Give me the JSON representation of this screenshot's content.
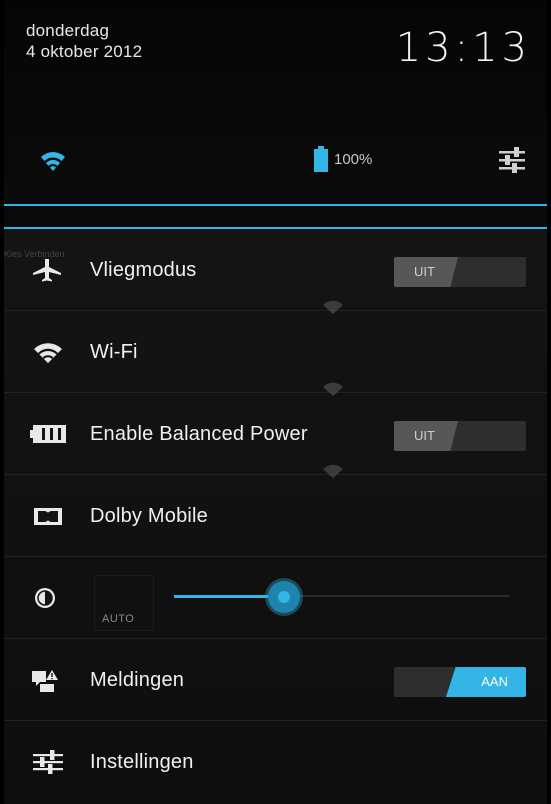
{
  "status": {
    "day": "donderdag",
    "date": "4 oktober 2012",
    "time": "13:13",
    "battery_percent": "100%",
    "battery_level": 1.0
  },
  "background_hint": "Kies Verbinden",
  "rows": [
    {
      "label": "Vliegmodus",
      "icon": "airplane-icon",
      "toggle": "UIT",
      "toggle_on": false
    },
    {
      "label": "Wi-Fi",
      "icon": "wifi-icon"
    },
    {
      "label": "Enable Balanced Power",
      "icon": "battery-icon",
      "toggle": "UIT",
      "toggle_on": false
    },
    {
      "label": "Dolby Mobile",
      "icon": "dolby-icon"
    },
    {
      "brightness_auto": "AUTO",
      "icon": "brightness-icon",
      "level": 0.38
    },
    {
      "label": "Meldingen",
      "icon": "notifications-icon",
      "toggle": "AAN",
      "toggle_on": true
    },
    {
      "label": "Instellingen",
      "icon": "settings-sliders-icon"
    }
  ],
  "colors": {
    "accent": "#33b5e5",
    "background": "#0a0a0a",
    "text": "#f0f0f0"
  }
}
